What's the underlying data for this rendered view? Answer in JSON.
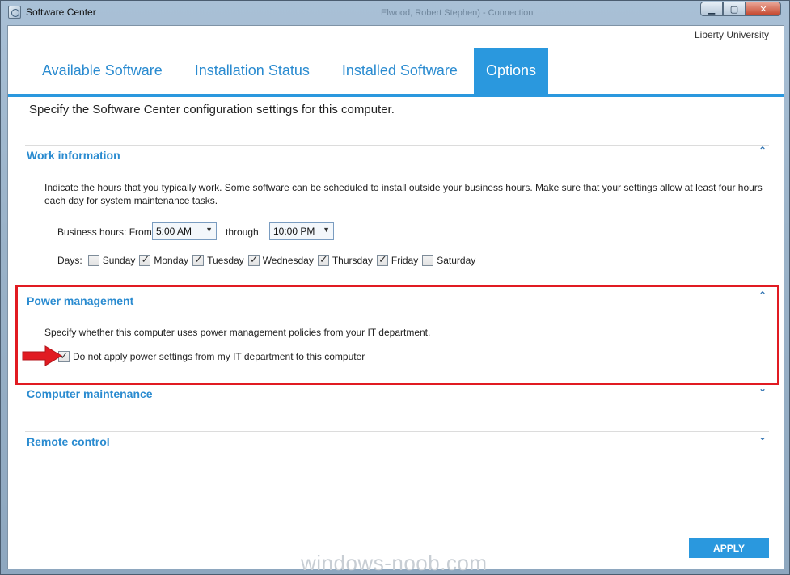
{
  "window": {
    "title": "Software Center",
    "ghost_title": "Elwood, Robert Stephen) - Connection",
    "minimize": "▁",
    "maximize": "▢",
    "close": "✕"
  },
  "org_name": "Liberty University",
  "tabs": [
    {
      "label": "Available Software",
      "active": false
    },
    {
      "label": "Installation Status",
      "active": false
    },
    {
      "label": "Installed Software",
      "active": false
    },
    {
      "label": "Options",
      "active": true
    }
  ],
  "intro": "Specify the Software Center configuration settings for this computer.",
  "work_information": {
    "title": "Work information",
    "chevron": "⌃",
    "description": "Indicate the hours that you typically work. Some software can be scheduled to install outside your business hours. Make sure that your settings allow at least four hours each day for system maintenance tasks.",
    "business_hours_label": "Business hours: From",
    "from_value": "5:00 AM",
    "through_label": "through",
    "to_value": "10:00 PM",
    "days_label": "Days:",
    "days": [
      {
        "label": "Sunday",
        "checked": false
      },
      {
        "label": "Monday",
        "checked": true
      },
      {
        "label": "Tuesday",
        "checked": true
      },
      {
        "label": "Wednesday",
        "checked": true
      },
      {
        "label": "Thursday",
        "checked": true
      },
      {
        "label": "Friday",
        "checked": true
      },
      {
        "label": "Saturday",
        "checked": false
      }
    ]
  },
  "power_management": {
    "title": "Power management",
    "chevron": "⌃",
    "description": "Specify whether this computer uses power management policies from your IT department.",
    "checkbox_label": "Do not apply power settings from my IT department to this computer",
    "checked": true
  },
  "computer_maintenance": {
    "title": "Computer maintenance",
    "chevron": "⌄"
  },
  "remote_control": {
    "title": "Remote control",
    "chevron": "⌄"
  },
  "apply_label": "APPLY",
  "watermark": "windows-noob.com",
  "colors": {
    "accent": "#2a98de",
    "highlight": "#e11b22"
  }
}
